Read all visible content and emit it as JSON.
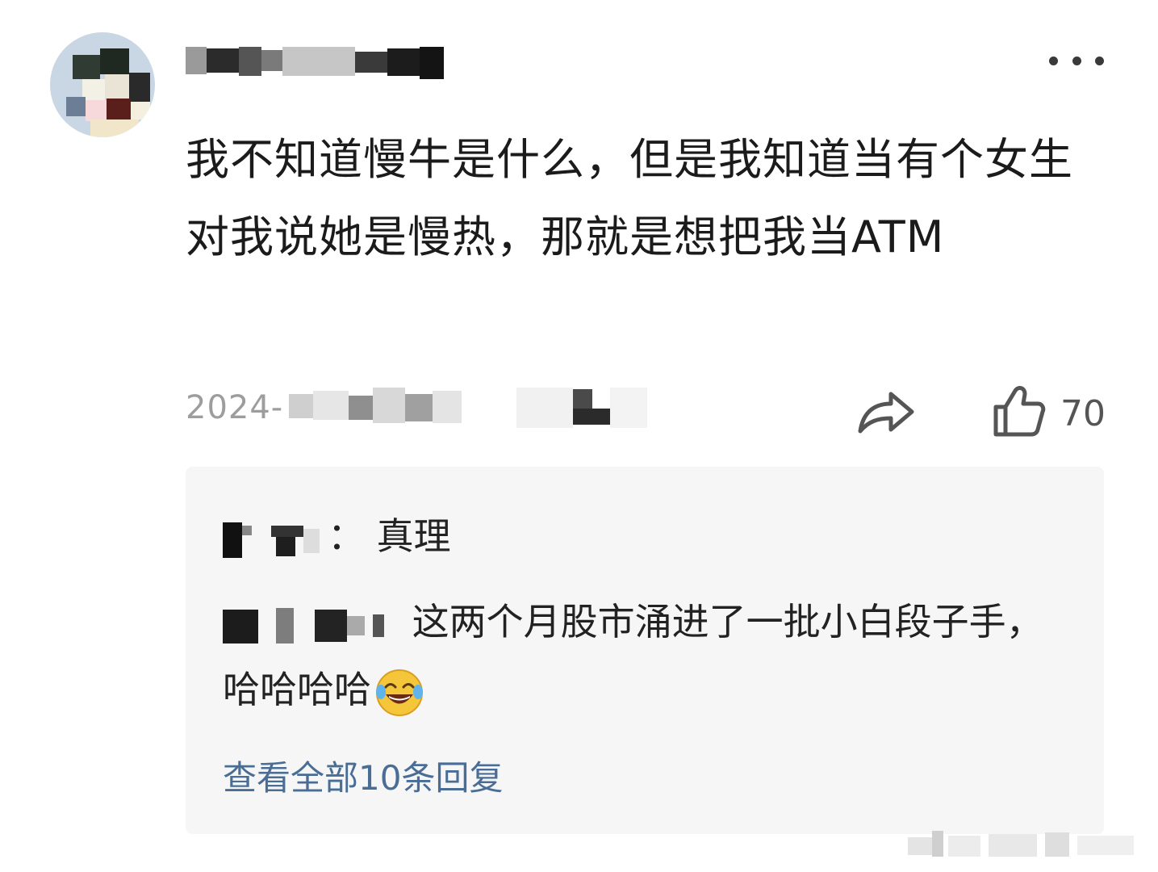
{
  "post": {
    "avatar_icon": "avatar-pixelated-icon",
    "username_blurred": true,
    "comment": "我不知道慢牛是什么，但是我知道当有个女生对我说她是慢热，那就是想把我当ATM",
    "date_prefix": "2024-",
    "like_count": "70",
    "icons": {
      "more": "more-dots-icon",
      "share": "share-arrow-icon",
      "like": "thumbs-up-icon"
    }
  },
  "replies": {
    "items": [
      {
        "name_blurred": true,
        "separator": "：",
        "text": "真理"
      },
      {
        "name_blurred": true,
        "separator": "",
        "text": "这两个月股市涌进了一批小白段子手，哈哈哈哈",
        "emoji": "tears-of-joy-emoji-icon"
      }
    ],
    "view_all_label": "查看全部10条回复"
  },
  "colors": {
    "background": "#ffffff",
    "reply_box": "#f6f6f6",
    "link": "#4a6d96",
    "text": "#1b1b1b",
    "muted": "#9d9d9d"
  }
}
